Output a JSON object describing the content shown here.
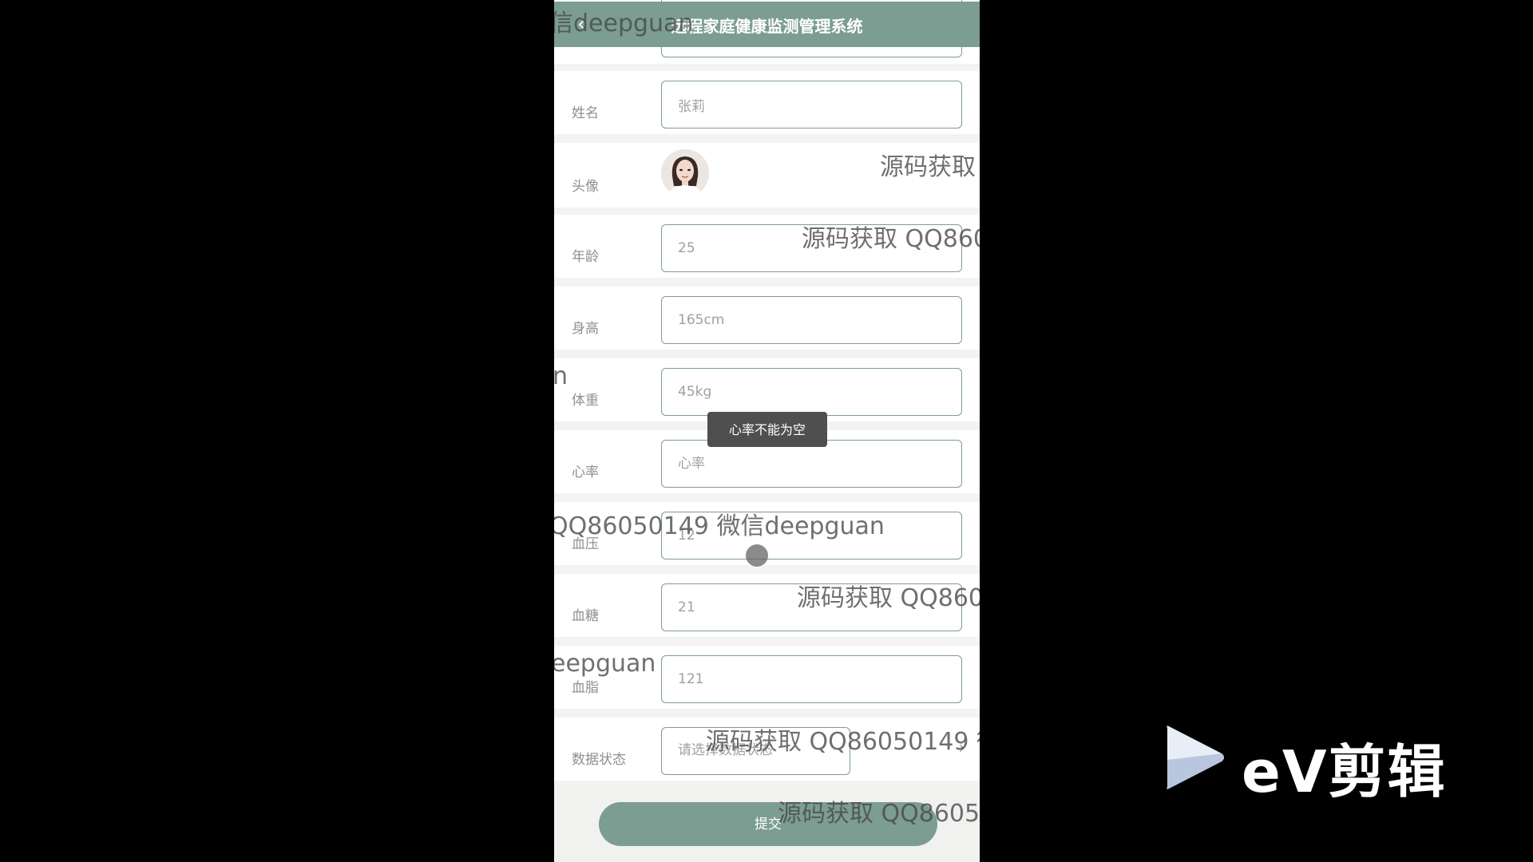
{
  "app": {
    "title": "远程家庭健康监测管理系统",
    "back_icon": "chevron-left-icon"
  },
  "form": {
    "fields": [
      {
        "key": "name",
        "label": "姓名",
        "value": "张莉",
        "placeholder": ""
      },
      {
        "key": "avatar",
        "label": "头像"
      },
      {
        "key": "age",
        "label": "年龄",
        "value": "25",
        "placeholder": ""
      },
      {
        "key": "height",
        "label": "身高",
        "value": "165cm",
        "placeholder": ""
      },
      {
        "key": "weight",
        "label": "体重",
        "value": "45kg",
        "placeholder": ""
      },
      {
        "key": "heart_rate",
        "label": "心率",
        "value": "",
        "placeholder": "心率"
      },
      {
        "key": "blood_pressure",
        "label": "血压",
        "value": "12",
        "placeholder": ""
      },
      {
        "key": "blood_sugar",
        "label": "血糖",
        "value": "21",
        "placeholder": ""
      },
      {
        "key": "blood_lipid",
        "label": "血脂",
        "value": "121",
        "placeholder": ""
      },
      {
        "key": "data_status",
        "label": "数据状态",
        "placeholder": "请选择数据状态"
      }
    ],
    "submit_label": "提交"
  },
  "toast": {
    "message": "心率不能为空"
  },
  "watermarks": [
    "信deepguan",
    "源码获取",
    "源码获取 QQ860",
    "n",
    "QQ86050149 微信deepguan",
    "源码获取 QQ860",
    "eepguan",
    "源码获取 QQ86050149 微",
    "源码获取 QQ8605"
  ],
  "branding": {
    "logo_text": "eV剪辑",
    "logo_icon": "play-triangle-icon"
  },
  "colors": {
    "accent": "#7c9d91",
    "background": "#000000",
    "toast_bg": "#4f4f4f"
  }
}
